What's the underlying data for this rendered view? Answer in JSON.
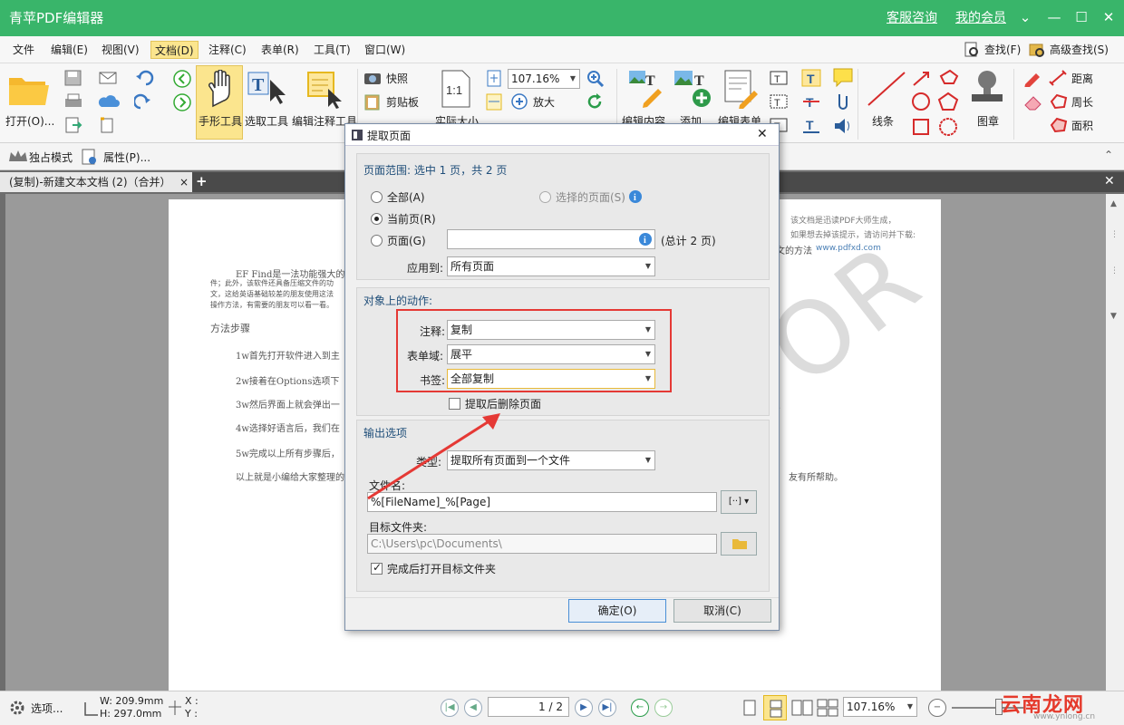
{
  "app": {
    "title": "青苹PDF编辑器",
    "support_link": "客服咨询",
    "member_link": "我的会员"
  },
  "window_controls": {
    "menu": "⌄",
    "minimize": "—",
    "maximize": "☐",
    "close": "✕"
  },
  "menu": [
    "文件",
    "编辑(E)",
    "视图(V)",
    "文档(D)",
    "注释(C)",
    "表单(R)",
    "工具(T)",
    "窗口(W)"
  ],
  "menu_right": {
    "find": "查找(F)",
    "advanced_find": "高级查找(S)"
  },
  "ribbon": {
    "open": "打开(O)...",
    "hand_tool": "手形工具",
    "select_tool": "选取工具",
    "edit_annotation_tool": "编辑注释工具",
    "snapshot": "快照",
    "clipboard": "剪贴板",
    "actual_size": "实际大小",
    "zoom_value": "107.16%",
    "zoom_in": "放大",
    "edit_content": "编辑内容",
    "add": "添加",
    "edit_form": "编辑表单",
    "line": "线条",
    "stamp": "图章",
    "distance": "距离",
    "perimeter": "周长",
    "area": "面积"
  },
  "secondbar": {
    "exclusive_mode": "独占模式",
    "properties": "属性(P)..."
  },
  "tab": {
    "title": "(复制)-新建文本文档 (2)（合并）",
    "close": "×",
    "add": "+"
  },
  "page_content": {
    "header1": "该文档是迅读PDF大师生成，",
    "header2": "如果想去掉该提示，请访问并下载:",
    "header_link": "www.pdfxd.com",
    "header_tail": "文的方法",
    "para1": "EF Find是一法功能强大的",
    "para2": "件；此外，该软件还具备压缩文件的功",
    "para3": "文，这给英语基础较差的朋友使用这法",
    "para4": "操作方法，有需要的朋友可以看一看。",
    "steps_title": "方法步骤",
    "step1": "1w首先打开软件进入到主",
    "step2": "2w接着在Options选项下",
    "step3": "3w然后界面上就会弹出一",
    "step4": "4w选择好语言后，我们在",
    "step5": "5w完成以上所有步骤后，",
    "closing": "以上就是小编给大家整理的",
    "closing_tail": "友有所帮助。",
    "watermark": "EDITOR"
  },
  "dialog": {
    "title": "提取页面",
    "close": "✕",
    "range_header": "页面范围: 选中 1 页，共 2 页",
    "opt_all": "全部(A)",
    "opt_selected": "选择的页面(S)",
    "opt_current": "当前页(R)",
    "opt_pages": "页面(G)",
    "total_pages": "(总计 2 页)",
    "apply_to_label": "应用到:",
    "apply_to_value": "所有页面",
    "actions_header": "对象上的动作:",
    "annotation_label": "注释:",
    "annotation_value": "复制",
    "form_label": "表单域:",
    "form_value": "展平",
    "bookmark_label": "书签:",
    "bookmark_value": "全部复制",
    "delete_after": "提取后删除页面",
    "output_header": "输出选项",
    "type_label": "类型:",
    "type_value": "提取所有页面到一个文件",
    "filename_label": "文件名:",
    "filename_value": "%[FileName]_%[Page]",
    "folder_label": "目标文件夹:",
    "folder_value": "C:\\Users\\pc\\Documents\\",
    "open_after": "完成后打开目标文件夹",
    "ok": "确定(O)",
    "cancel": "取消(C)"
  },
  "status": {
    "options": "选项...",
    "width": "W: 209.9mm",
    "height": "H: 297.0mm",
    "x": "X :",
    "y": "Y :",
    "page": "1 / 2",
    "zoom": "107.16%"
  },
  "site_watermark": {
    "text": "云南龙网",
    "url": "www.ynlong.cn"
  },
  "colors": {
    "titlebar": "#39b56a",
    "highlight": "#e53935",
    "accent": "#1f4e79"
  }
}
